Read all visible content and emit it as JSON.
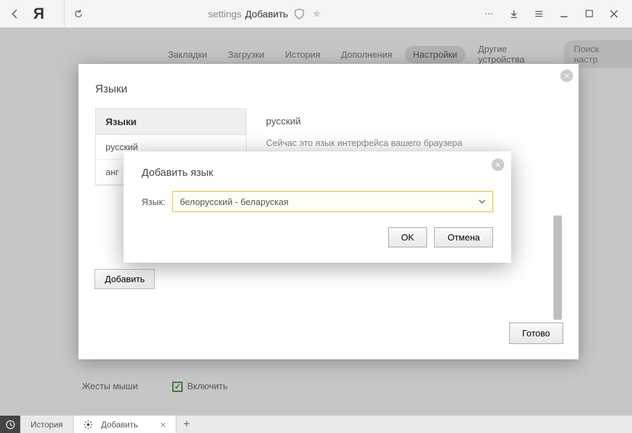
{
  "titlebar": {
    "address_left": "settings",
    "address_right": "Добавить"
  },
  "nav": {
    "tabs": [
      "Закладки",
      "Загрузки",
      "История",
      "Дополнения",
      "Настройки",
      "Другие устройства"
    ],
    "active_index": 4,
    "search_placeholder": "Поиск настр"
  },
  "lang_popup": {
    "title": "Языки",
    "sidebar_head": "Языки",
    "sidebar_items": [
      "русский",
      "анг"
    ],
    "add_btn": "Добавить",
    "main_title": "русский",
    "main_desc": "Сейчас это язык интерфейса вашего браузера",
    "done_btn": "Готово"
  },
  "add_modal": {
    "title": "Добавить язык",
    "label": "Язык:",
    "selected": "белорусский - беларуская",
    "ok": "OK",
    "cancel": "Отмена"
  },
  "gestures": {
    "label": "Жесты мыши",
    "checkbox_label": "Включить"
  },
  "bottom": {
    "tab1": "История",
    "tab2": "Добавить"
  }
}
